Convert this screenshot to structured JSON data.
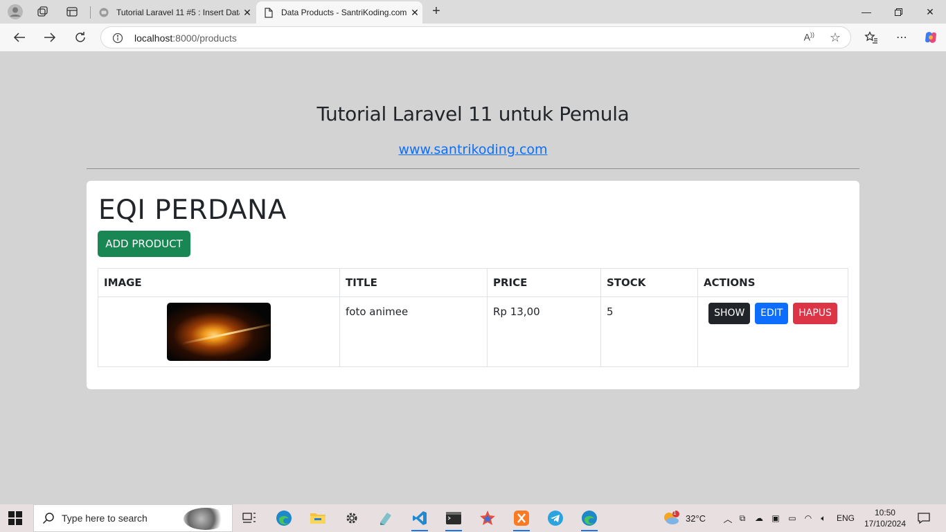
{
  "browser": {
    "tabs": [
      {
        "title": "Tutorial Laravel 11 #5 : Insert Data",
        "active": false
      },
      {
        "title": "Data Products - SantriKoding.com",
        "active": true
      }
    ],
    "address": {
      "host": "localhost",
      "path": ":8000/products"
    }
  },
  "page": {
    "heading": "Tutorial Laravel 11 untuk Pemula",
    "site_link": "www.santrikoding.com",
    "owner_name": "EQI PERDANA",
    "add_button": "ADD PRODUCT",
    "table": {
      "headers": [
        "IMAGE",
        "TITLE",
        "PRICE",
        "STOCK",
        "ACTIONS"
      ],
      "rows": [
        {
          "title": "foto animee",
          "price": "Rp 13,00",
          "stock": "5",
          "actions": {
            "show": "SHOW",
            "edit": "EDIT",
            "delete": "HAPUS"
          }
        }
      ]
    }
  },
  "taskbar": {
    "search_placeholder": "Type here to search",
    "weather": "32°C",
    "weather_badge": "1",
    "language": "ENG",
    "time": "10:50",
    "date": "17/10/2024"
  },
  "colors": {
    "page_bg": "#d3d3d3",
    "add_button": "#198754",
    "show_button": "#212529",
    "edit_button": "#0d6efd",
    "delete_button": "#dc3545",
    "link": "#0d6efd"
  }
}
